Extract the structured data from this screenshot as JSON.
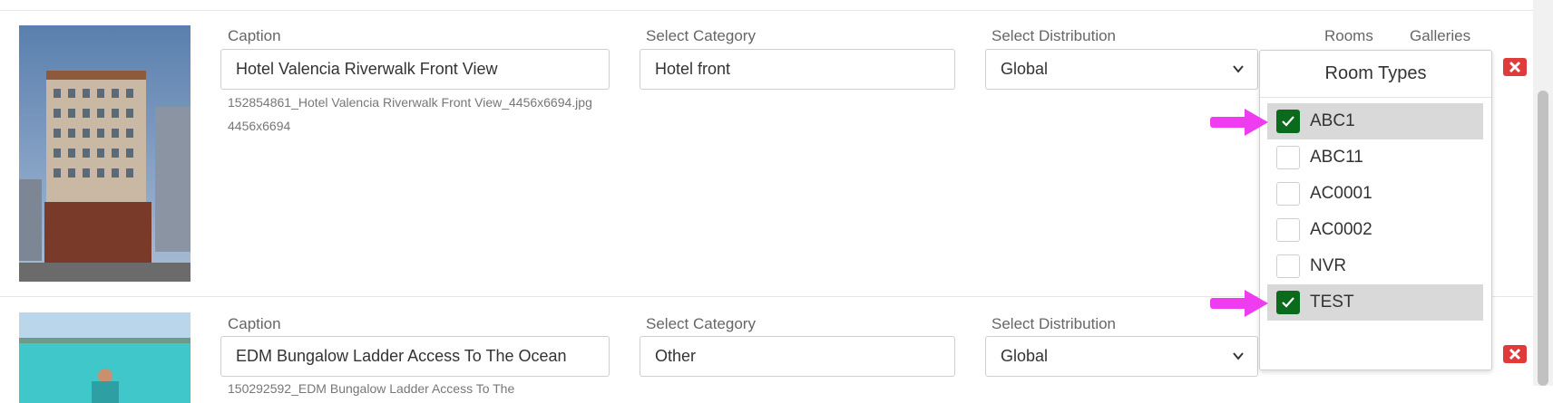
{
  "rows": [
    {
      "caption_label": "Caption",
      "caption_value": "Hotel Valencia Riverwalk Front View",
      "filename": "152854861_Hotel Valencia Riverwalk Front View_4456x6694.jpg",
      "dimensions": "4456x6694",
      "category_label": "Select Category",
      "category_value": "Hotel front",
      "distribution_label": "Select Distribution",
      "distribution_value": "Global"
    },
    {
      "caption_label": "Caption",
      "caption_value": "EDM Bungalow Ladder Access To The Ocean",
      "filename": "150292592_EDM Bungalow Ladder Access To The",
      "category_label": "Select Category",
      "category_value": "Other",
      "distribution_label": "Select Distribution",
      "distribution_value": "Global"
    }
  ],
  "columns": {
    "rooms": "Rooms",
    "galleries": "Galleries"
  },
  "room_types": {
    "title": "Room Types",
    "items": [
      {
        "label": "ABC1",
        "checked": true
      },
      {
        "label": "ABC11",
        "checked": false
      },
      {
        "label": "AC0001",
        "checked": false
      },
      {
        "label": "AC0002",
        "checked": false
      },
      {
        "label": "NVR",
        "checked": false
      },
      {
        "label": "TEST",
        "checked": true
      }
    ]
  },
  "colors": {
    "checked": "#0a6b1d",
    "remove": "#e03b3b",
    "arrow": "#f03cf0"
  }
}
